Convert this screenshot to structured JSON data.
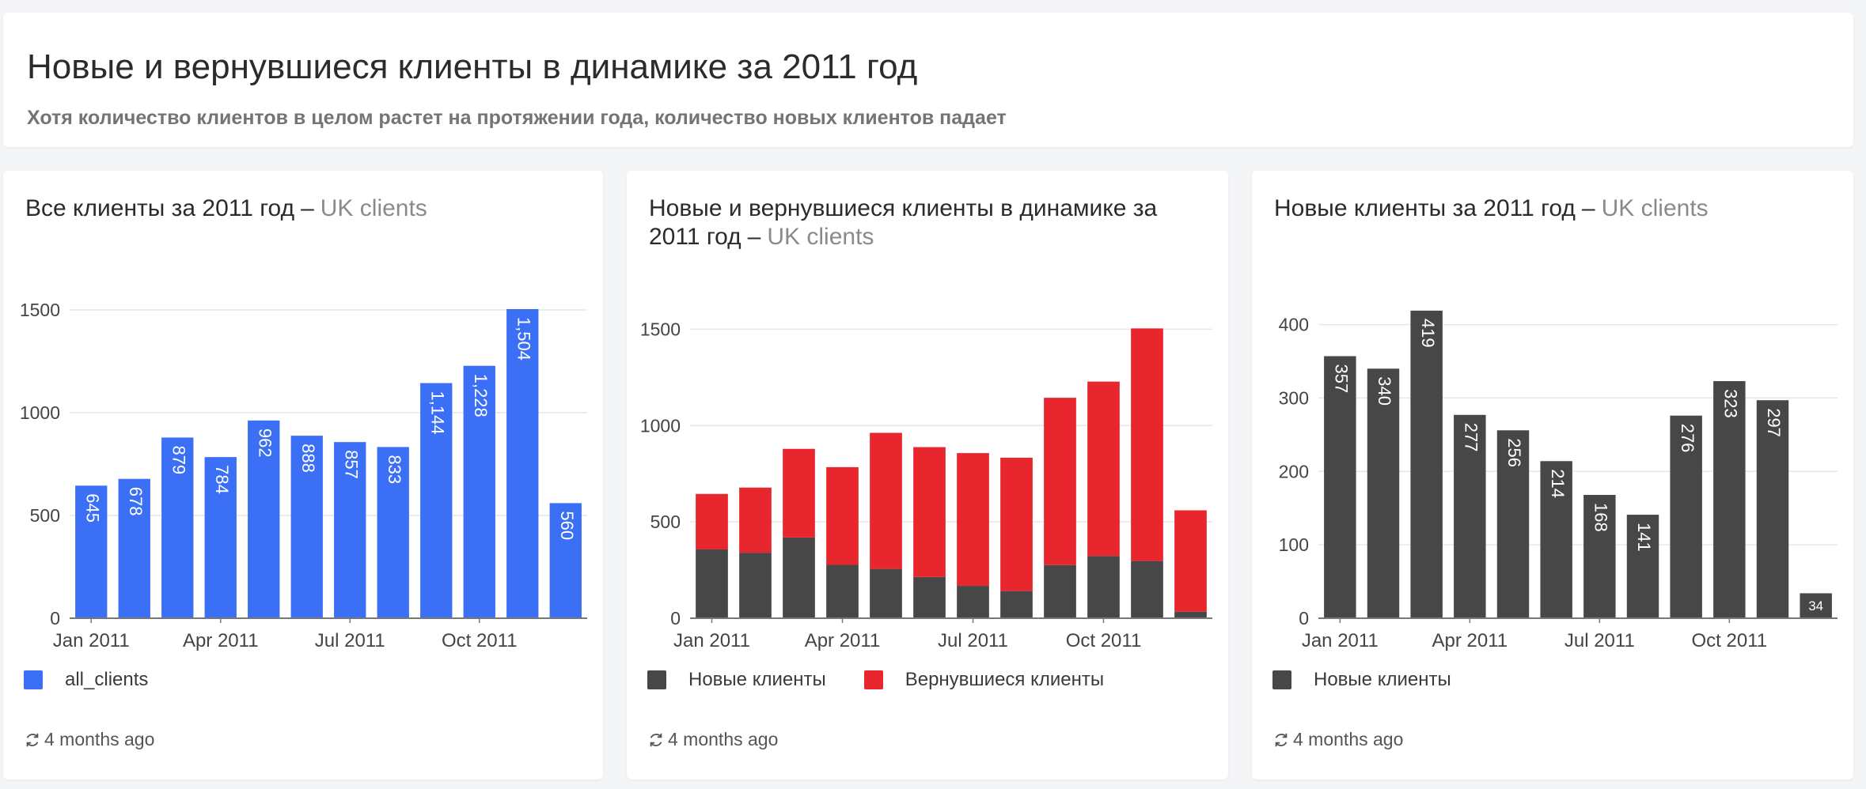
{
  "header": {
    "title": "Новые и вернувшиеся клиенты в динамике за 2011 год",
    "subtitle": "Хотя количество клиентов в целом растет на протяжении года, количество новых клиентов падает"
  },
  "cards": [
    {
      "title": "Все клиенты за 2011 год",
      "separator": "–",
      "source": "UK clients",
      "updated": "4 months ago",
      "legend": [
        "all_clients"
      ]
    },
    {
      "title": "Новые и вернувшиеся клиенты в динамике за 2011 год",
      "separator": "–",
      "source": "UK clients",
      "updated": "4 months ago",
      "legend": [
        "Новые клиенты",
        "Вернувшиеся клиенты"
      ]
    },
    {
      "title": "Новые клиенты за 2011 год",
      "separator": "–",
      "source": "UK clients",
      "updated": "4 months ago",
      "legend": [
        "Новые клиенты"
      ]
    }
  ],
  "colors": {
    "blue": "#3b6ff5",
    "red": "#e8262e",
    "dark": "#474747",
    "grid": "#e6e6e6",
    "axis": "#777777"
  },
  "chart_data": [
    {
      "type": "bar",
      "x": [
        "Jan 2011",
        "Feb 2011",
        "Mar 2011",
        "Apr 2011",
        "May 2011",
        "Jun 2011",
        "Jul 2011",
        "Aug 2011",
        "Sep 2011",
        "Oct 2011",
        "Nov 2011",
        "Dec 2011"
      ],
      "x_tick_labels": [
        "Jan 2011",
        "Apr 2011",
        "Jul 2011",
        "Oct 2011"
      ],
      "series": [
        {
          "name": "all_clients",
          "values": [
            645,
            678,
            879,
            784,
            962,
            888,
            857,
            833,
            1144,
            1228,
            1504,
            560
          ],
          "labels": [
            "645",
            "678",
            "879",
            "784",
            "962",
            "888",
            "857",
            "833",
            "1,144",
            "1,228",
            "1,504",
            "560"
          ]
        }
      ],
      "y_ticks": [
        0,
        500,
        1000,
        1500
      ],
      "ylim": [
        0,
        1500
      ],
      "grid": true,
      "legend": "bottom-left"
    },
    {
      "type": "bar",
      "stacked": true,
      "x": [
        "Jan 2011",
        "Feb 2011",
        "Mar 2011",
        "Apr 2011",
        "May 2011",
        "Jun 2011",
        "Jul 2011",
        "Aug 2011",
        "Sep 2011",
        "Oct 2011",
        "Nov 2011",
        "Dec 2011"
      ],
      "x_tick_labels": [
        "Jan 2011",
        "Apr 2011",
        "Jul 2011",
        "Oct 2011"
      ],
      "series": [
        {
          "name": "Новые клиенты",
          "values": [
            357,
            340,
            419,
            277,
            256,
            214,
            168,
            141,
            276,
            323,
            297,
            34
          ]
        },
        {
          "name": "Вернувшиеся клиенты",
          "values": [
            288,
            338,
            460,
            507,
            706,
            674,
            689,
            692,
            868,
            905,
            1207,
            526
          ]
        }
      ],
      "y_ticks": [
        0,
        500,
        1000,
        1500
      ],
      "ylim": [
        0,
        1600
      ],
      "grid": true,
      "legend": "bottom-left"
    },
    {
      "type": "bar",
      "x": [
        "Jan 2011",
        "Feb 2011",
        "Mar 2011",
        "Apr 2011",
        "May 2011",
        "Jun 2011",
        "Jul 2011",
        "Aug 2011",
        "Sep 2011",
        "Oct 2011",
        "Nov 2011",
        "Dec 2011"
      ],
      "x_tick_labels": [
        "Jan 2011",
        "Apr 2011",
        "Jul 2011",
        "Oct 2011"
      ],
      "series": [
        {
          "name": "Новые клиенты",
          "values": [
            357,
            340,
            419,
            277,
            256,
            214,
            168,
            141,
            276,
            323,
            297,
            34
          ],
          "labels": [
            "357",
            "340",
            "419",
            "277",
            "256",
            "214",
            "168",
            "141",
            "276",
            "323",
            "297",
            "34"
          ]
        }
      ],
      "y_ticks": [
        0,
        100,
        200,
        300,
        400
      ],
      "ylim": [
        0,
        420
      ],
      "grid": true,
      "legend": "bottom-left"
    }
  ]
}
